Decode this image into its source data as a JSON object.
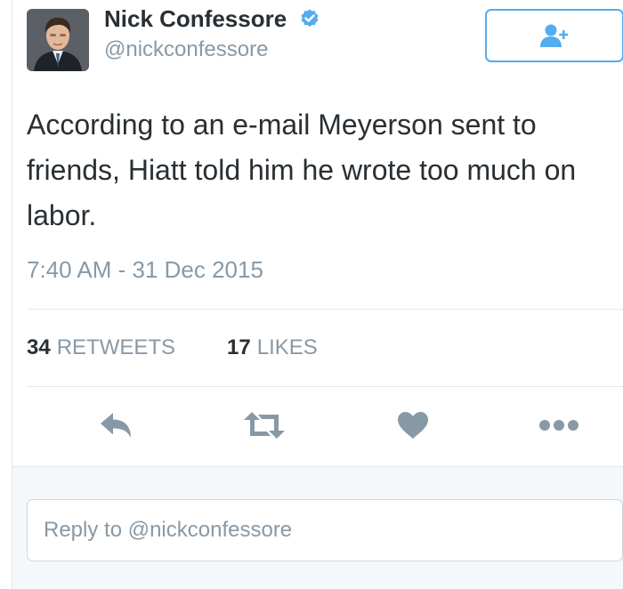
{
  "tweet": {
    "author": {
      "display_name": "Nick Confessore",
      "handle": "@nickconfessore",
      "verified": true,
      "avatar_icon": "avatar-photo"
    },
    "follow_button_icon": "follow-user-icon",
    "text": "According to an e-mail Meyerson sent to friends, Hiatt told him he wrote too much on labor.",
    "timestamp": "7:40 AM - 31 Dec 2015",
    "stats": {
      "retweets_count": "34",
      "retweets_label": "RETWEETS",
      "likes_count": "17",
      "likes_label": "LIKES"
    },
    "actions": [
      "reply-icon",
      "retweet-icon",
      "like-icon",
      "more-icon"
    ]
  },
  "reply": {
    "placeholder": "Reply to @nickconfessore"
  },
  "colors": {
    "accent": "#55acee",
    "icon_gray": "#8899a6",
    "text": "#292f33",
    "border": "#e1e8ed"
  }
}
